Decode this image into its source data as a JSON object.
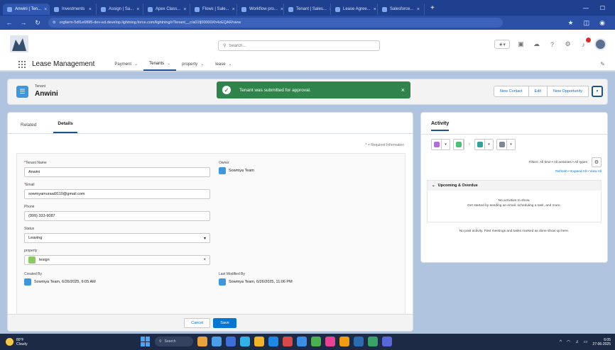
{
  "browser": {
    "tabs": [
      "Anwini | Ten...",
      "Investments",
      "Assign | Sa...",
      "Apex Class...",
      "Flows | Sale...",
      "Workflow pro...",
      "Tenant | Sales...",
      "Lease Agree...",
      "Salesforce..."
    ],
    "url": "orgfarm-5df1e6f6f5-dev-ed.develop.lightning.force.com/lightning/r/Tenant__c/a01fj00000Xh4zEQAR/view"
  },
  "global_header": {
    "search_placeholder": "Search..."
  },
  "nav": {
    "app_name": "Lease Management",
    "items": [
      {
        "label": "Payment"
      },
      {
        "label": "Tenants"
      },
      {
        "label": "property"
      },
      {
        "label": "lease"
      }
    ]
  },
  "record": {
    "object_type": "Tenant",
    "name": "Anwini",
    "actions": [
      "New Contact",
      "Edit",
      "New Opportunity"
    ]
  },
  "toast": {
    "message": "Tenant was submitted for approval."
  },
  "detail": {
    "tabs": [
      "Related",
      "Details"
    ],
    "required_note": "= Required Information",
    "fields": {
      "tenant_name_label": "Tenant Name",
      "tenant_name_value": "Anwini",
      "owner_label": "Owner",
      "owner_value": "Sowmya Team",
      "email_label": "Email",
      "email_value": "sowmyamuraai9110@gmail.com",
      "phone_label": "Phone",
      "phone_value": "(999) 333-9087",
      "status_label": "Status",
      "status_value": "Leaving",
      "property_label": "property",
      "property_value": "tesign",
      "created_by_label": "Created By",
      "created_by_value": "Sowmya Team, 6/26/2025, 6:05 AM",
      "modified_by_label": "Last Modified By",
      "modified_by_value": "Sowmya Team, 6/26/2025, 11:06 PM"
    },
    "cancel_label": "Cancel",
    "save_label": "Save"
  },
  "activity": {
    "title": "Activity",
    "filters": "Filters: All time • All activities • All types",
    "links": "Refresh • Expand All • View All",
    "upcoming_header": "Upcoming & Overdue",
    "no_activities": "No activities to show.",
    "get_started": "Get started by sending an email, scheduling a task, and more.",
    "past_activity": "No past activity. Past meetings and tasks marked as done show up here."
  },
  "taskbar": {
    "weather_temp": "80°F",
    "weather_desc": "Cloudy",
    "search_label": "Search",
    "time": "6:05",
    "date": "27-06-2025"
  },
  "colors": {
    "brand_blue": "#1b5297",
    "toast_green": "#2e844a",
    "save_blue": "#0176d3"
  }
}
